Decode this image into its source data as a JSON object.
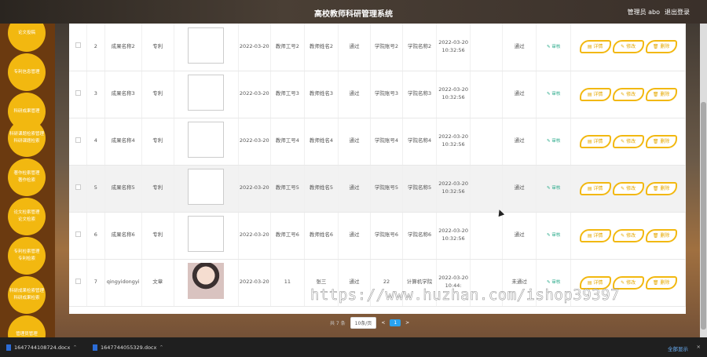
{
  "header": {
    "title": "高校教师科研管理系统",
    "user": "管理员 abo",
    "logout": "退出登录"
  },
  "sidebar": [
    {
      "label": "论文投稿",
      "sub": ""
    },
    {
      "label": "专利信息管理",
      "sub": ""
    },
    {
      "label": "科研成果管理",
      "sub": ""
    },
    {
      "label": "科研课题检索管理",
      "sub": "科研课题检索"
    },
    {
      "label": "著作检索管理",
      "sub": "著作检索"
    },
    {
      "label": "论文检索管理",
      "sub": "论文检索"
    },
    {
      "label": "专利检索管理",
      "sub": "专利检索"
    },
    {
      "label": "科研成果检索管理",
      "sub": "科研成果检索"
    },
    {
      "label": "管理员管理",
      "sub": ""
    }
  ],
  "table": {
    "rows": [
      {
        "no": "2",
        "name": "成果名称2",
        "type": "专利",
        "date": "2022-03-20",
        "teacher_no": "教师工号2",
        "teacher_name": "教师姓名2",
        "status1": "通过",
        "college_no": "学院账号2",
        "college_name": "学院名称2",
        "time": "2022-03-20 10:32:56",
        "note": "",
        "status2": "通过",
        "review": "审核"
      },
      {
        "no": "3",
        "name": "成果名称3",
        "type": "专利",
        "date": "2022-03-20",
        "teacher_no": "教师工号3",
        "teacher_name": "教师姓名3",
        "status1": "通过",
        "college_no": "学院账号3",
        "college_name": "学院名称3",
        "time": "2022-03-20 10:32:56",
        "note": "",
        "status2": "通过",
        "review": "审核"
      },
      {
        "no": "4",
        "name": "成果名称4",
        "type": "专利",
        "date": "2022-03-20",
        "teacher_no": "教师工号4",
        "teacher_name": "教师姓名4",
        "status1": "通过",
        "college_no": "学院账号4",
        "college_name": "学院名称4",
        "time": "2022-03-20 10:32:56",
        "note": "",
        "status2": "通过",
        "review": "审核"
      },
      {
        "no": "5",
        "name": "成果名称5",
        "type": "专利",
        "date": "2022-03-20",
        "teacher_no": "教师工号5",
        "teacher_name": "教师姓名5",
        "status1": "通过",
        "college_no": "学院账号5",
        "college_name": "学院名称5",
        "time": "2022-03-20 10:32:56",
        "note": "",
        "status2": "通过",
        "review": "审核"
      },
      {
        "no": "6",
        "name": "成果名称6",
        "type": "专利",
        "date": "2022-03-20",
        "teacher_no": "教师工号6",
        "teacher_name": "教师姓名6",
        "status1": "通过",
        "college_no": "学院账号6",
        "college_name": "学院名称6",
        "time": "2022-03-20 10:32:56",
        "note": "",
        "status2": "通过",
        "review": "审核"
      },
      {
        "no": "7",
        "name": "qingyidongyi",
        "type": "文章",
        "date": "2022-03-20",
        "teacher_no": "11",
        "teacher_name": "张三",
        "status1": "通过",
        "college_no": "22",
        "college_name": "计算机学院",
        "time": "2022-03-20 10:44:",
        "note": "",
        "status2": "未通过",
        "review": "审核"
      }
    ],
    "actions": {
      "detail": "详情",
      "edit": "修改",
      "delete": "删除"
    }
  },
  "pagination": {
    "total": "共 7 条",
    "page_size": "10条/页",
    "prev": "<",
    "page": "1",
    "next": ">"
  },
  "downloads": [
    {
      "file": "1647744108724.docx"
    },
    {
      "file": "1647744055329.docx"
    }
  ],
  "download_bar": {
    "show_all": "全部显示",
    "close": "×"
  },
  "watermark": "https://www.huzhan.com/ishop39397",
  "colors": {
    "accent": "#f2b810",
    "sidebar_bg": "#6b3a10",
    "pager": "#2aa3f0"
  }
}
